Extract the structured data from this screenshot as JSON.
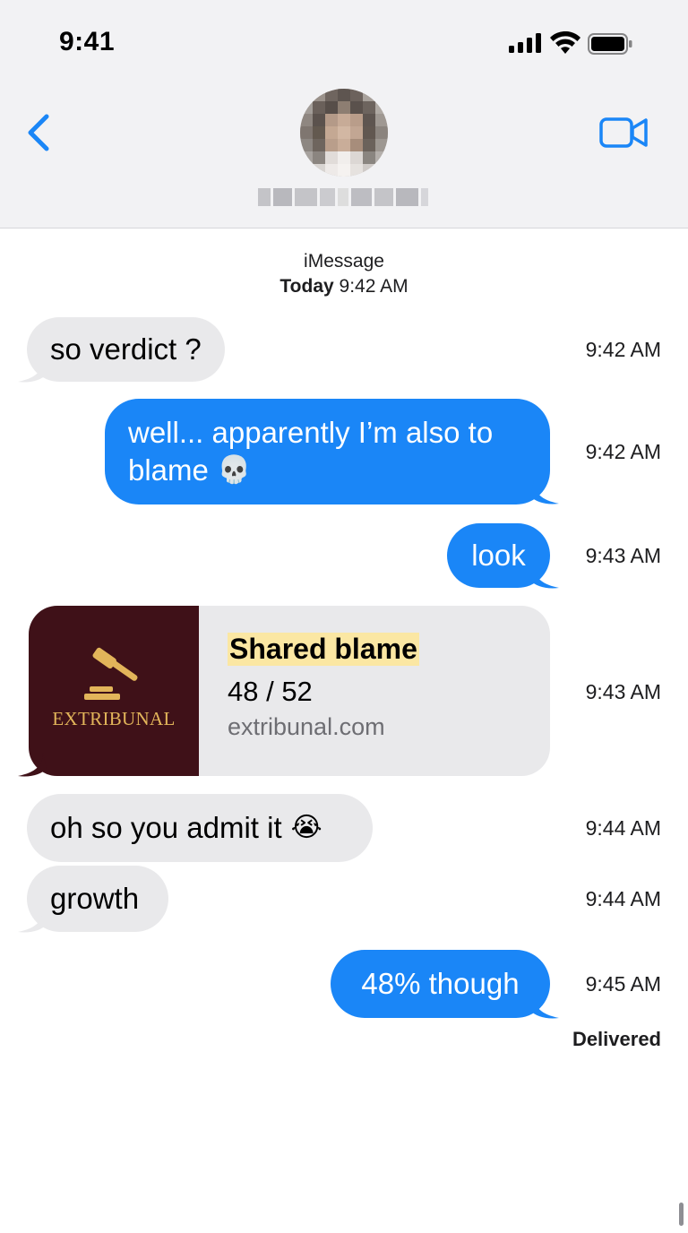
{
  "status_bar": {
    "time": "9:41",
    "icons": [
      "signal-icon",
      "wifi-icon",
      "battery-icon"
    ]
  },
  "header": {
    "back_icon": "chevron-left-icon",
    "video_icon": "video-camera-icon",
    "accent_color": "#1a86f7",
    "contact_name": "(blurred)"
  },
  "conversation": {
    "service": "iMessage",
    "date_day": "Today",
    "date_time": "9:42 AM"
  },
  "messages": [
    {
      "side": "incoming",
      "text": "so verdict ?",
      "time": "9:42 AM"
    },
    {
      "side": "outgoing",
      "text_line1": "well... apparently I’m also to",
      "text_line2": "blame",
      "emoji": "💀",
      "emoji_name": "skull-emoji",
      "time": "9:42 AM"
    },
    {
      "side": "outgoing",
      "text": "look",
      "time": "9:43 AM"
    },
    {
      "side": "incoming",
      "type": "link",
      "time": "9:43 AM"
    },
    {
      "side": "incoming",
      "text": "oh so you admit it",
      "emoji": "😭",
      "emoji_name": "loudly-crying-face-emoji",
      "time": "9:44 AM"
    },
    {
      "side": "incoming",
      "text": "growth",
      "time": "9:44 AM"
    },
    {
      "side": "outgoing",
      "text": "48% though",
      "time": "9:45 AM"
    }
  ],
  "link_card": {
    "brand": "EXTRIBUNAL",
    "brand_icon": "gavel-icon",
    "title": "Shared blame",
    "subtitle": "48 / 52",
    "domain": "extribunal.com",
    "thumb_color": "#3f1118",
    "brand_color": "#e2b55a",
    "title_highlight": "#fbe7a3"
  },
  "delivery_status": "Delivered",
  "colors": {
    "incoming_bubble": "#e9e9eb",
    "outgoing_bubble": "#1a86f7"
  }
}
